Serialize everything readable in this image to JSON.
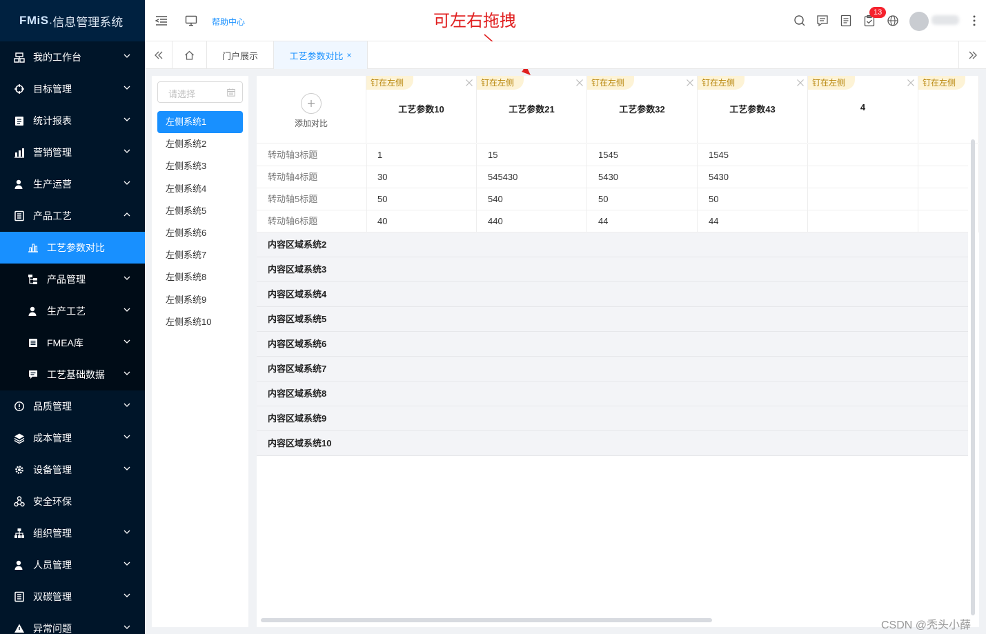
{
  "app": {
    "logo_brand": "FMiS",
    "logo_text": "·信息管理系统"
  },
  "sidebar": {
    "items": [
      {
        "label": "我的工作台",
        "icon": "workbench-icon"
      },
      {
        "label": "目标管理",
        "icon": "target-icon"
      },
      {
        "label": "统计报表",
        "icon": "report-icon"
      },
      {
        "label": "营销管理",
        "icon": "chart-icon"
      },
      {
        "label": "生产运营",
        "icon": "user-icon"
      },
      {
        "label": "产品工艺",
        "icon": "document-icon"
      }
    ],
    "sub_items": [
      {
        "label": "工艺参数对比",
        "icon": "bar-chart-icon"
      },
      {
        "label": "产品管理",
        "icon": "tree-icon"
      },
      {
        "label": "生产工艺",
        "icon": "user-icon"
      },
      {
        "label": "FMEA库",
        "icon": "list-icon"
      },
      {
        "label": "工艺基础数据",
        "icon": "message-icon"
      }
    ],
    "items_after": [
      {
        "label": "品质管理",
        "icon": "alert-icon"
      },
      {
        "label": "成本管理",
        "icon": "layers-icon"
      },
      {
        "label": "设备管理",
        "icon": "gear-icon"
      },
      {
        "label": "安全环保",
        "icon": "cluster-icon"
      },
      {
        "label": "组织管理",
        "icon": "org-icon"
      },
      {
        "label": "人员管理",
        "icon": "user-icon"
      },
      {
        "label": "双碳管理",
        "icon": "document-icon"
      },
      {
        "label": "异常问题",
        "icon": "warning-icon"
      }
    ]
  },
  "header": {
    "help": "帮助中心",
    "annotation": "可左右拖拽",
    "badge_count": "13"
  },
  "tabs": {
    "portal": "门户展示",
    "current": "工艺参数对比",
    "close": "×"
  },
  "left_panel": {
    "placeholder": "请选择",
    "items": [
      "左侧系统1",
      "左侧系统2",
      "左侧系统3",
      "左侧系统4",
      "左侧系统5",
      "左侧系统6",
      "左侧系统7",
      "左侧系统8",
      "左侧系统9",
      "左侧系统10"
    ]
  },
  "compare": {
    "add_label": "添加对比",
    "pin_label": "钉在左侧",
    "columns": [
      "工艺参数10",
      "工艺参数21",
      "工艺参数32",
      "工艺参数43",
      "4",
      ""
    ],
    "rows": [
      {
        "label": "转动轴3标题",
        "values": [
          "1",
          "15",
          "1545",
          "1545",
          "",
          ""
        ]
      },
      {
        "label": "转动轴4标题",
        "values": [
          "30",
          "545430",
          "5430",
          "5430",
          "",
          ""
        ]
      },
      {
        "label": "转动轴5标题",
        "values": [
          "50",
          "540",
          "50",
          "50",
          "",
          ""
        ]
      },
      {
        "label": "转动轴6标题",
        "values": [
          "40",
          "440",
          "44",
          "44",
          "",
          ""
        ]
      }
    ],
    "groups": [
      "内容区域系统2",
      "内容区域系统3",
      "内容区域系统4",
      "内容区域系统5",
      "内容区域系统6",
      "内容区域系统7",
      "内容区域系统8",
      "内容区域系统9",
      "内容区域系统10"
    ]
  },
  "watermark": "CSDN @秃头小薛",
  "colors": {
    "sidebar_bg": "#001529",
    "accent": "#1890ff",
    "pin_bg": "#fdf3d6",
    "annotation": "#e02020"
  }
}
